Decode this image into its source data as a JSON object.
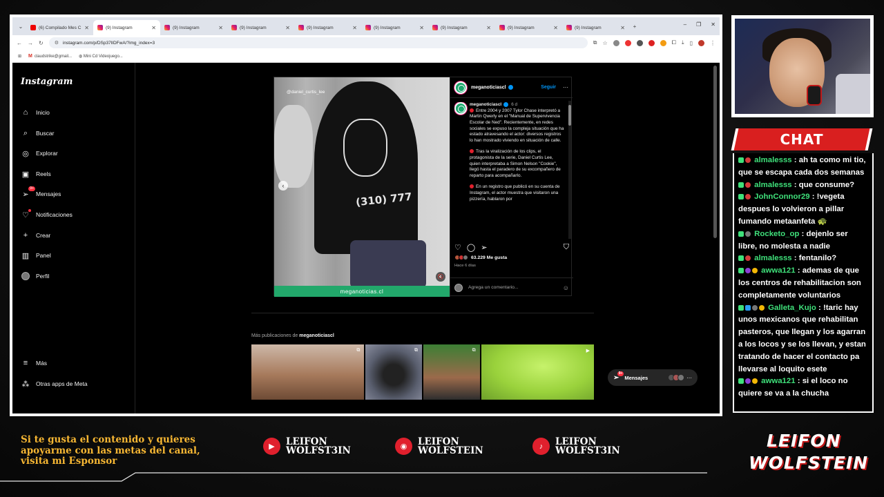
{
  "browser": {
    "tabs": [
      {
        "label": "(6) Compilado Mes C",
        "type": "yt"
      },
      {
        "label": "(9) Instagram",
        "type": "ig",
        "active": true
      },
      {
        "label": "(9) Instagram",
        "type": "ig"
      },
      {
        "label": "(9) Instagram",
        "type": "ig"
      },
      {
        "label": "(9) Instagram",
        "type": "ig"
      },
      {
        "label": "(9) Instagram",
        "type": "ig"
      },
      {
        "label": "(9) Instagram",
        "type": "ig"
      },
      {
        "label": "(9) Instagram",
        "type": "ig"
      },
      {
        "label": "(9) Instagram",
        "type": "ig"
      }
    ],
    "url": "instagram.com/p/DSp37lIDFwA/?img_index=3",
    "bookmarks": [
      "claudstrike@gmail...",
      "Mini Cd Videojuego..."
    ]
  },
  "instagram": {
    "logo": "Instagram",
    "nav": [
      {
        "label": "Inicio",
        "icon": "home-icon",
        "glyph": "⌂"
      },
      {
        "label": "Buscar",
        "icon": "search-icon",
        "glyph": "⌕"
      },
      {
        "label": "Explorar",
        "icon": "compass-icon",
        "glyph": "◎"
      },
      {
        "label": "Reels",
        "icon": "reels-icon",
        "glyph": "▣"
      },
      {
        "label": "Mensajes",
        "icon": "messages-icon",
        "glyph": "➢",
        "badge": "9+"
      },
      {
        "label": "Notificaciones",
        "icon": "heart-icon",
        "glyph": "♡",
        "dot": true
      },
      {
        "label": "Crear",
        "icon": "plus-icon",
        "glyph": "+"
      },
      {
        "label": "Panel",
        "icon": "panel-icon",
        "glyph": "▥"
      },
      {
        "label": "Perfil",
        "icon": "profile-avatar",
        "glyph": ""
      }
    ],
    "nav_bottom": [
      {
        "label": "Más",
        "icon": "menu-icon",
        "glyph": "≡"
      },
      {
        "label": "Otras apps de Meta",
        "icon": "meta-apps-icon",
        "glyph": "⁂"
      }
    ],
    "post": {
      "watermark": "@daniel_curtis_lee",
      "hoodie_text": "(310) 777",
      "media_footer": "meganoticias.cl",
      "username": "meganoticiascl",
      "follow_label": "Seguir",
      "time": "6 d",
      "caption": [
        "Entre 2004 y 2007 Tylor Chase interpretó a Martin Qwerly en el \"Manual de Supervivencia Escolar de Ned\". Recientemente, en redes sociales se expuso la compleja situación que ha estado atravesando el actor: diversos registros lo han mostrado viviendo en situación de calle.",
        "Tras la viralización de los clips, el protagonista de la serie, Daniel Curtis Lee, quien interpretaba a Simon Nelson \"Cookie\", llegó hasta el paradero de su excompañero de reparto para acompañarlo.",
        "En un registro que publicó en su cuenta de Instagram, el actor muestra que visitaron una pizzería, hablaron por"
      ],
      "likes": "63.229 Me gusta",
      "posted_ago": "Hace 6 días",
      "comment_placeholder": "Agrega un comentario..."
    },
    "more_posts_prefix": "Más publicaciones de ",
    "more_posts_user": "meganoticiascl",
    "messages_pill": {
      "label": "Mensajes",
      "badge": "9+"
    }
  },
  "chat": {
    "title": "CHAT",
    "messages": [
      {
        "badges": [
          "k",
          "r"
        ],
        "user": "almalesss",
        "text": "ah ta como mi tio, que se escapa cada dos semanas"
      },
      {
        "badges": [
          "k",
          "r"
        ],
        "user": "almalesss",
        "text": "que consume?"
      },
      {
        "badges": [
          "k",
          "r"
        ],
        "user": "JohnConnor29",
        "text": "!vegeta despues lo volvieron a pillar fumando metaanfeta 🐢"
      },
      {
        "badges": [
          "k",
          "g"
        ],
        "user": "Rocketo_op",
        "text": "dejenlo ser libre, no molesta a nadie"
      },
      {
        "badges": [
          "k",
          "r"
        ],
        "user": "almalesss",
        "text": "fentanilo?"
      },
      {
        "badges": [
          "k",
          "p",
          "y"
        ],
        "user": "awwa121",
        "text": "ademas de que los centros de rehabilitacion son completamente voluntarios"
      },
      {
        "badges": [
          "k",
          "b",
          "g",
          "y"
        ],
        "user": "Galleta_Kujo",
        "text": "!taric hay unos mexicanos que rehabilitan pasteros, que llegan y los agarran a los locos y se los llevan, y estan tratando de hacer el contacto pa llevarse al loquito esete"
      },
      {
        "badges": [
          "k",
          "p",
          "y"
        ],
        "user": "awwa121",
        "text": "si el loco no quiere se va a la chucha"
      }
    ]
  },
  "overlay": {
    "promo": "Si te gusta el contenido y quieres apoyarme con las metas del canal, visita mi Esponsor",
    "socials": [
      {
        "platform": "youtube",
        "icon": "youtube-icon",
        "glyph": "▶",
        "line1": "LEIFON",
        "line2": "WOLFST3IN"
      },
      {
        "platform": "instagram",
        "icon": "instagram-icon",
        "glyph": "◉",
        "line1": "LEIFON",
        "line2": "WOLFSTEIN"
      },
      {
        "platform": "tiktok",
        "icon": "tiktok-icon",
        "glyph": "♪",
        "line1": "LEIFON",
        "line2": "WOLFST3IN"
      }
    ],
    "logo_line1": "LEIFON",
    "logo_line2": "WOLFSTEIN"
  },
  "colors": {
    "accent_red": "#d91f1f",
    "promo_gold": "#f7b733",
    "chat_user_green": "#3fe07a",
    "ig_blue": "#0095f6"
  }
}
